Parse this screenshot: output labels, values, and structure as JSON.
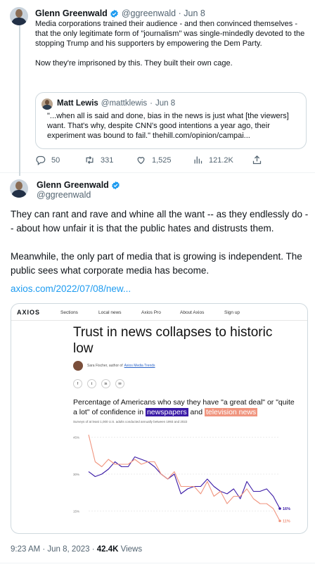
{
  "tweet1": {
    "author_name": "Glenn Greenwald",
    "handle": "@ggreenwald",
    "date": "Jun 8",
    "paragraphs": [
      "Media corporations trained their audience - and then convinced themselves - that the only legitimate form of \"journalism\" was single-mindedly devoted to the stopping Trump and his supporters by empowering the Dem Party.",
      "Now they're imprisoned by this. They built their own cage."
    ],
    "quote": {
      "author_name": "Matt Lewis",
      "handle": "@mattklewis",
      "date": "Jun 8",
      "text": "\"...when all is said and done, bias in the news is just what [the viewers] want. That's why, despite CNN's good intentions a year ago, their experiment was bound to fail.\" thehill.com/opinion/campai..."
    },
    "actions": {
      "replies": "50",
      "retweets": "331",
      "likes": "1,525",
      "views": "121.2K"
    }
  },
  "tweet2": {
    "author_name": "Glenn Greenwald",
    "handle": "@ggreenwald",
    "paragraphs": [
      "They can rant and rave and whine all the want -- as they endlessly do -- about how unfair it is that the public hates and distrusts them.",
      "Meanwhile, the only part of media that is growing is independent. The public sees what corporate media has become."
    ],
    "link": "axios.com/2022/07/08/new...",
    "card": {
      "logo": "AXIOS",
      "nav": [
        "Sections",
        "Local news",
        "Axios Pro",
        "About Axios",
        "Sign up"
      ],
      "headline": "Trust in news collapses to historic low",
      "author_prefix": "Sara Fischer, author of",
      "author_link": "Axios Media Trends",
      "share_icons": [
        "f",
        "t",
        "in",
        "✉"
      ],
      "chart_title_prefix": "Percentage of Americans who say they have \"a great deal\" or \"quite a lot\" of confidence in",
      "chart_title_np": "newspapers",
      "chart_title_and": "and",
      "chart_title_tv": "television news",
      "chart_subtitle": "Surveys of at least 1,000 U.S. adults conducted annually between 1993 and 2022"
    },
    "meta": {
      "time": "9:23 AM · Jun 8, 2023 ·",
      "views": "42.4K",
      "views_label": "Views"
    }
  },
  "colors": {
    "verified": "#1d9bf0",
    "link": "#1d9bf0",
    "newspapers": "#3a1aa6",
    "television": "#f0957f"
  },
  "chart_data": {
    "type": "line",
    "title": "Percentage of Americans who say they have \"a great deal\" or \"quite a lot\" of confidence in newspapers and television news",
    "subtitle": "Surveys of at least 1,000 U.S. adults conducted annually between 1993 and 2022",
    "y_ticks": [
      "45%",
      "30%",
      "15%"
    ],
    "ylim": [
      8,
      48
    ],
    "xlim": [
      1993,
      2022
    ],
    "end_labels": [
      "16%",
      "11%"
    ],
    "series": [
      {
        "name": "newspapers",
        "color": "#3a1aa6",
        "x": [
          1993,
          1994,
          1995,
          1996,
          1997,
          1998,
          1999,
          2000,
          2001,
          2002,
          2003,
          2004,
          2005,
          2006,
          2007,
          2008,
          2009,
          2010,
          2011,
          2012,
          2013,
          2014,
          2015,
          2016,
          2017,
          2018,
          2019,
          2020,
          2021,
          2022
        ],
        "y": [
          31,
          29,
          30,
          32,
          35,
          33,
          33,
          37,
          36,
          35,
          33,
          30,
          28,
          30,
          22,
          24,
          25,
          25,
          28,
          25,
          23,
          22,
          24,
          20,
          27,
          23,
          23,
          24,
          21,
          16
        ]
      },
      {
        "name": "television news",
        "color": "#f0957f",
        "x": [
          1993,
          1994,
          1995,
          1996,
          1997,
          1998,
          1999,
          2000,
          2001,
          2002,
          2003,
          2004,
          2005,
          2006,
          2007,
          2008,
          2009,
          2010,
          2011,
          2012,
          2013,
          2014,
          2015,
          2016,
          2017,
          2018,
          2019,
          2020,
          2021,
          2022
        ],
        "y": [
          46,
          35,
          33,
          36,
          34,
          34,
          34,
          36,
          34,
          35,
          35,
          30,
          28,
          31,
          25,
          25,
          25,
          22,
          27,
          21,
          23,
          18,
          21,
          21,
          24,
          20,
          18,
          18,
          16,
          11
        ]
      }
    ]
  }
}
